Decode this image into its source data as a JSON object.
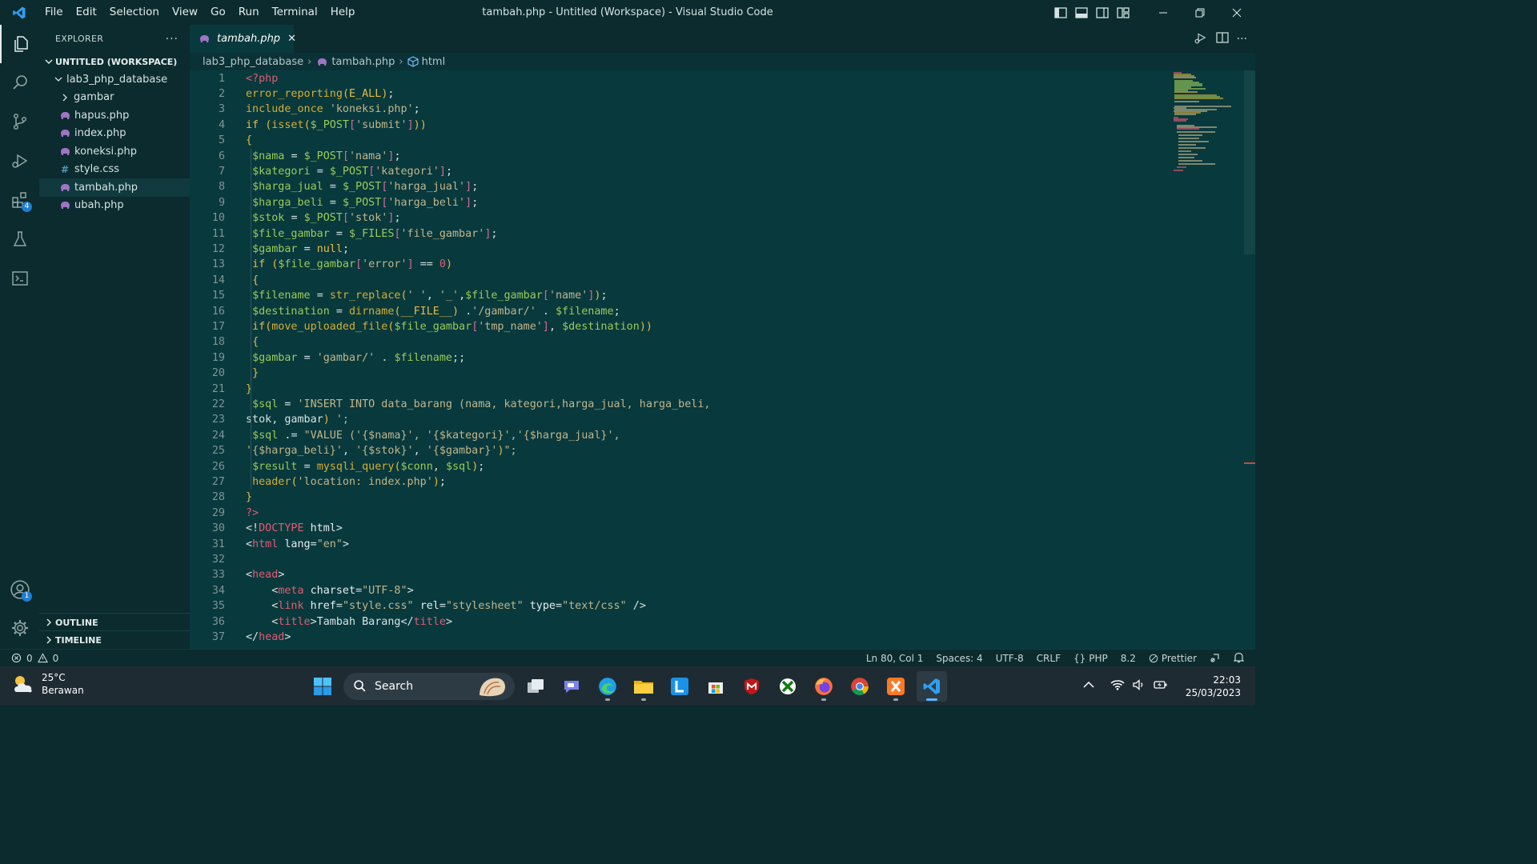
{
  "window": {
    "title": "tambah.php - Untitled (Workspace) - Visual Studio Code",
    "menu": [
      "File",
      "Edit",
      "Selection",
      "View",
      "Go",
      "Run",
      "Terminal",
      "Help"
    ],
    "accent": "#1f7fd1"
  },
  "activity_bar": {
    "items": [
      {
        "name": "explorer-icon"
      },
      {
        "name": "search-icon"
      },
      {
        "name": "source-control-icon"
      },
      {
        "name": "run-debug-icon"
      },
      {
        "name": "extensions-icon",
        "badge": "4"
      },
      {
        "name": "testing-icon"
      },
      {
        "name": "terminal-icon"
      }
    ],
    "accounts_badge": "1"
  },
  "explorer": {
    "header": "EXPLORER",
    "more": "···",
    "workspace": "UNTITLED (WORKSPACE)",
    "folder": "lab3_php_database",
    "items": [
      {
        "label": "gambar",
        "type": "folder"
      },
      {
        "label": "hapus.php",
        "type": "php"
      },
      {
        "label": "index.php",
        "type": "php"
      },
      {
        "label": "koneksi.php",
        "type": "php"
      },
      {
        "label": "style.css",
        "type": "css"
      },
      {
        "label": "tambah.php",
        "type": "php",
        "selected": true
      },
      {
        "label": "ubah.php",
        "type": "php"
      }
    ],
    "outline": "OUTLINE",
    "timeline": "TIMELINE"
  },
  "tab": {
    "label": "tambah.php",
    "close": "✕"
  },
  "breadcrumb": {
    "folder": "lab3_php_database",
    "file": "tambah.php",
    "symbol": "html",
    "sep": "›"
  },
  "editor": {
    "lines": [
      {
        "n": "1",
        "code": "<?php"
      },
      {
        "n": "2",
        "code": "error_reporting(E_ALL);"
      },
      {
        "n": "3",
        "code": "include_once 'koneksi.php';"
      },
      {
        "n": "4",
        "code": "if (isset($_POST['submit']))"
      },
      {
        "n": "5",
        "code": "{"
      },
      {
        "n": "6",
        "code": " $nama = $_POST['nama'];"
      },
      {
        "n": "7",
        "code": " $kategori = $_POST['kategori'];"
      },
      {
        "n": "8",
        "code": " $harga_jual = $_POST['harga_jual'];"
      },
      {
        "n": "9",
        "code": " $harga_beli = $_POST['harga_beli'];"
      },
      {
        "n": "10",
        "code": " $stok = $_POST['stok'];"
      },
      {
        "n": "11",
        "code": " $file_gambar = $_FILES['file_gambar'];"
      },
      {
        "n": "12",
        "code": " $gambar = null;"
      },
      {
        "n": "13",
        "code": " if ($file_gambar['error'] == 0)"
      },
      {
        "n": "14",
        "code": " {"
      },
      {
        "n": "15",
        "code": " $filename = str_replace(' ', '_',$file_gambar['name']);"
      },
      {
        "n": "16",
        "code": " $destination = dirname(__FILE__) .'/gambar/' . $filename;"
      },
      {
        "n": "17",
        "code": " if(move_uploaded_file($file_gambar['tmp_name'], $destination))"
      },
      {
        "n": "18",
        "code": " {"
      },
      {
        "n": "19",
        "code": " $gambar = 'gambar/' . $filename;;"
      },
      {
        "n": "20",
        "code": " }"
      },
      {
        "n": "21",
        "code": "}"
      },
      {
        "n": "22",
        "code": " $sql = 'INSERT INTO data_barang (nama, kategori,harga_jual, harga_beli,"
      },
      {
        "n": "23",
        "code": "stok, gambar) ';"
      },
      {
        "n": "24",
        "code": " $sql .= \"VALUE ('{$nama}', '{$kategori}','{$harga_jual}',"
      },
      {
        "n": "25",
        "code": "'{$harga_beli}', '{$stok}', '{$gambar}')\";"
      },
      {
        "n": "26",
        "code": " $result = mysqli_query($conn, $sql);"
      },
      {
        "n": "27",
        "code": " header('location: index.php');"
      },
      {
        "n": "28",
        "code": "}"
      },
      {
        "n": "29",
        "code": "?>"
      },
      {
        "n": "30",
        "code": "<!DOCTYPE html>"
      },
      {
        "n": "31",
        "code": "<html lang=\"en\">"
      },
      {
        "n": "32",
        "code": ""
      },
      {
        "n": "33",
        "code": "<head>"
      },
      {
        "n": "34",
        "code": "    <meta charset=\"UTF-8\">"
      },
      {
        "n": "35",
        "code": "    <link href=\"style.css\" rel=\"stylesheet\" type=\"text/css\" />"
      },
      {
        "n": "36",
        "code": "    <title>Tambah Barang</title>"
      },
      {
        "n": "37",
        "code": "</head>"
      }
    ]
  },
  "statusbar": {
    "errors": "0",
    "warnings": "0",
    "position": "Ln 80, Col 1",
    "spaces": "Spaces: 4",
    "encoding": "UTF-8",
    "eol": "CRLF",
    "language": "PHP",
    "version": "8.2",
    "formatter": "Prettier"
  },
  "taskbar": {
    "temp": "25°C",
    "condition": "Berawan",
    "search": "Search",
    "time": "22:03",
    "date": "25/03/2023"
  }
}
